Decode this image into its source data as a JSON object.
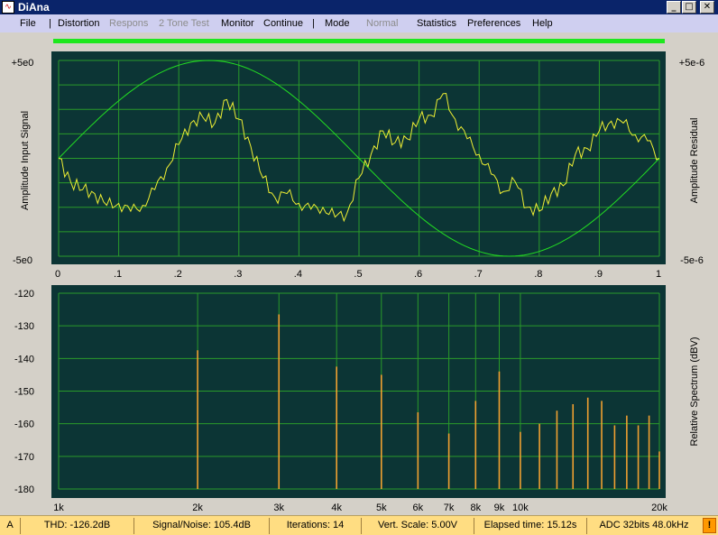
{
  "window": {
    "title": "DiAna"
  },
  "menu": {
    "items": [
      {
        "label": "File",
        "enabled": true
      },
      {
        "label": "Distortion",
        "enabled": true
      },
      {
        "label": "Respons",
        "enabled": false
      },
      {
        "label": "2 Tone Test",
        "enabled": false
      },
      {
        "label": "Monitor",
        "enabled": true
      },
      {
        "label": "Continue",
        "enabled": true
      },
      {
        "label": "Mode",
        "enabled": true
      },
      {
        "label": "Normal",
        "enabled": false
      },
      {
        "label": "Statistics",
        "enabled": true
      },
      {
        "label": "Preferences",
        "enabled": true
      },
      {
        "label": "Help",
        "enabled": true
      }
    ],
    "separator": "|"
  },
  "progress": 1.0,
  "colors": {
    "plot_bg": "#0c3535",
    "grid": "#2a9a2a",
    "signal": "#22dd22",
    "residual": "#eeee33",
    "spectrum": "#f0a030",
    "progress": "#1ee81e",
    "titlebar": "#0a246a",
    "menubar": "#cfcff0",
    "statusbar": "#ffdd82"
  },
  "chart_data": [
    {
      "type": "line",
      "left_label": "Amplitude Input Signal",
      "right_label": "Amplitude Residual",
      "left_ticks": [
        "+5e0",
        "-5e0"
      ],
      "right_ticks": [
        "+5e-6",
        "-5e-6"
      ],
      "x_ticks": [
        "0",
        ".1",
        ".2",
        ".3",
        ".4",
        ".5",
        ".6",
        ".7",
        ".8",
        ".9",
        "1"
      ],
      "xlim": [
        0,
        1
      ],
      "ylim": [
        -5,
        5
      ],
      "residual_ylim": [
        -5e-06,
        5e-06
      ],
      "grid": true,
      "series": [
        {
          "role": "signal",
          "x": [
            0,
            0.05,
            0.1,
            0.15,
            0.2,
            0.25,
            0.3,
            0.35,
            0.4,
            0.45,
            0.5,
            0.55,
            0.6,
            0.65,
            0.7,
            0.75,
            0.8,
            0.85,
            0.9,
            0.95,
            1
          ],
          "y": [
            0,
            1.55,
            2.94,
            4.05,
            4.76,
            5.0,
            4.76,
            4.05,
            2.94,
            1.55,
            0,
            -1.55,
            -2.94,
            -4.05,
            -4.76,
            -5.0,
            -4.76,
            -4.05,
            -2.94,
            -1.55,
            0
          ]
        },
        {
          "role": "residual",
          "x": [
            0,
            0.02,
            0.04,
            0.06,
            0.08,
            0.1,
            0.12,
            0.14,
            0.16,
            0.18,
            0.2,
            0.22,
            0.24,
            0.26,
            0.28,
            0.3,
            0.32,
            0.34,
            0.36,
            0.38,
            0.4,
            0.42,
            0.44,
            0.46,
            0.48,
            0.5,
            0.52,
            0.54,
            0.56,
            0.58,
            0.6,
            0.62,
            0.64,
            0.66,
            0.68,
            0.7,
            0.72,
            0.74,
            0.76,
            0.78,
            0.8,
            0.82,
            0.84,
            0.86,
            0.88,
            0.9,
            0.92,
            0.94,
            0.96,
            0.98,
            1.0
          ],
          "y": [
            0.0,
            -1.2e-06,
            -1.6e-06,
            -1.8e-06,
            -2.4e-06,
            -2.3e-06,
            -2.7e-06,
            -2.4e-06,
            -1.6e-06,
            -5e-07,
            7e-07,
            1.8e-06,
            2.1e-06,
            1.8e-06,
            3e-06,
            2e-06,
            6e-07,
            -1e-06,
            -2e-06,
            -1.8e-06,
            -2.3e-06,
            -2.6e-06,
            -2.5e-06,
            -3e-06,
            -2.8e-06,
            -1e-06,
            2e-07,
            1.4e-06,
            8e-07,
            1e-06,
            2e-06,
            2.2e-06,
            3.3e-06,
            2e-06,
            1e-06,
            2e-07,
            -8e-07,
            -1.7e-06,
            -1.2e-06,
            -2.5e-06,
            -2.7e-06,
            -1.8e-06,
            -1.4e-06,
            2e-07,
            5e-07,
            1.4e-06,
            1.9e-06,
            1.8e-06,
            1.2e-06,
            9e-07,
            0.0
          ]
        }
      ]
    },
    {
      "type": "bar",
      "right_label": "Relative Spectrum (dBV)",
      "y_ticks": [
        "-120",
        "-130",
        "-140",
        "-150",
        "-160",
        "-170",
        "-180"
      ],
      "ylim": [
        -180,
        -120
      ],
      "x_scale": "log",
      "xlim": [
        1000,
        20000
      ],
      "x_ticks": [
        {
          "label": "1k",
          "value": 1000
        },
        {
          "label": "2k",
          "value": 2000
        },
        {
          "label": "3k",
          "value": 3000
        },
        {
          "label": "4k",
          "value": 4000
        },
        {
          "label": "5k",
          "value": 5000
        },
        {
          "label": "6k",
          "value": 6000
        },
        {
          "label": "7k",
          "value": 7000
        },
        {
          "label": "8k",
          "value": 8000
        },
        {
          "label": "9k",
          "value": 9000
        },
        {
          "label": "10k",
          "value": 10000
        },
        {
          "label": "20k",
          "value": 20000
        }
      ],
      "grid": true,
      "bars": {
        "x": [
          2000,
          3000,
          4000,
          5000,
          6000,
          7000,
          8000,
          9000,
          10000,
          11000,
          12000,
          13000,
          14000,
          15000,
          16000,
          17000,
          18000,
          19000,
          20000
        ],
        "y": [
          -137.5,
          -126.5,
          -142.5,
          -145,
          -156.5,
          -163,
          -153,
          -144,
          -162.5,
          -160,
          -156,
          -154,
          -152,
          -153,
          -160.5,
          -157.5,
          -160.5,
          -157.5,
          -168.5
        ]
      }
    }
  ],
  "status": {
    "channel": "A",
    "thd": "THD: -126.2dB",
    "snr": "Signal/Noise:  105.4dB",
    "iterations": "Iterations: 14",
    "scale": "Vert. Scale: 5.00V",
    "elapsed": "Elapsed time: 15.12s",
    "adc": "ADC 32bits 48.0kHz",
    "warn": "!"
  }
}
